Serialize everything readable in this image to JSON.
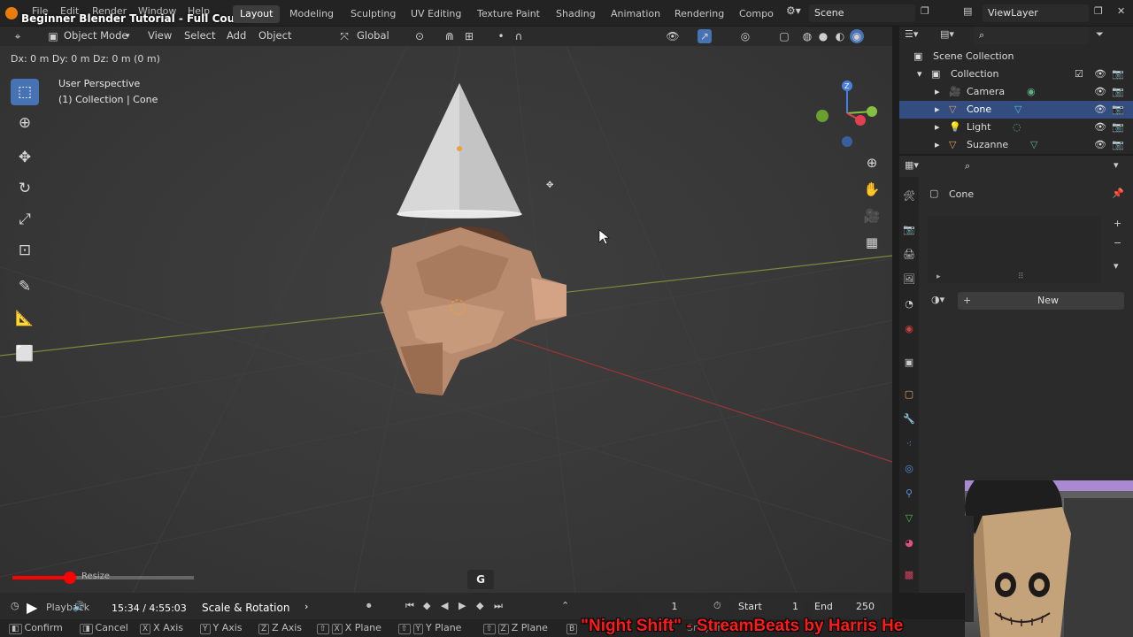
{
  "video": {
    "title": "Beginner Blender Tutorial - Full Course",
    "time": "15:34 / 4:55:03",
    "chapter": "Scale & Rotation",
    "playback_label": "Playback",
    "music": "\"Night Shift\" - StreamBeats by Harris He",
    "progress": 0.053,
    "tooltip": "Resize"
  },
  "menu": [
    "File",
    "Edit",
    "Render",
    "Window",
    "Help"
  ],
  "workspaces": [
    {
      "label": "Layout",
      "active": true
    },
    {
      "label": "Modeling"
    },
    {
      "label": "Sculpting"
    },
    {
      "label": "UV Editing"
    },
    {
      "label": "Texture Paint"
    },
    {
      "label": "Shading"
    },
    {
      "label": "Animation"
    },
    {
      "label": "Rendering"
    },
    {
      "label": "Compo"
    }
  ],
  "scene": "Scene",
  "view_layer": "ViewLayer",
  "header": {
    "mode": "Object Mode",
    "view": "View",
    "select": "Select",
    "add": "Add",
    "object": "Object",
    "orientation": "Global"
  },
  "viewport": {
    "transform_info": "Dx: 0 m   Dy: 0 m   Dz: 0 m (0 m)",
    "perspective": "User Perspective",
    "collection_info": "(1) Collection | Cone",
    "key_hint": "G"
  },
  "outliner": {
    "root": "Scene Collection",
    "collection": "Collection",
    "items": [
      {
        "name": "Camera"
      },
      {
        "name": "Cone",
        "selected": true
      },
      {
        "name": "Light"
      },
      {
        "name": "Suzanne"
      }
    ]
  },
  "properties": {
    "object_name": "Cone",
    "new_button": "New"
  },
  "timeline": {
    "frame": "1",
    "start_label": "Start",
    "start": "1",
    "end_label": "End",
    "end": "250"
  },
  "status": {
    "confirm": "Confirm",
    "cancel": "Cancel",
    "x_axis": "X Axis",
    "y_axis": "Y Axis",
    "z_axis": "Z Axis",
    "x_plane": "X Plane",
    "y_plane": "Y Plane",
    "z_plane": "Z Plane",
    "snap_invert": "Snap Invert"
  },
  "colors": {
    "accent": "#4772b3",
    "selection": "#334d80",
    "youtube_red": "#ff0000",
    "music_text": "#ff1a1a",
    "suzanne": "#b98b6e"
  }
}
